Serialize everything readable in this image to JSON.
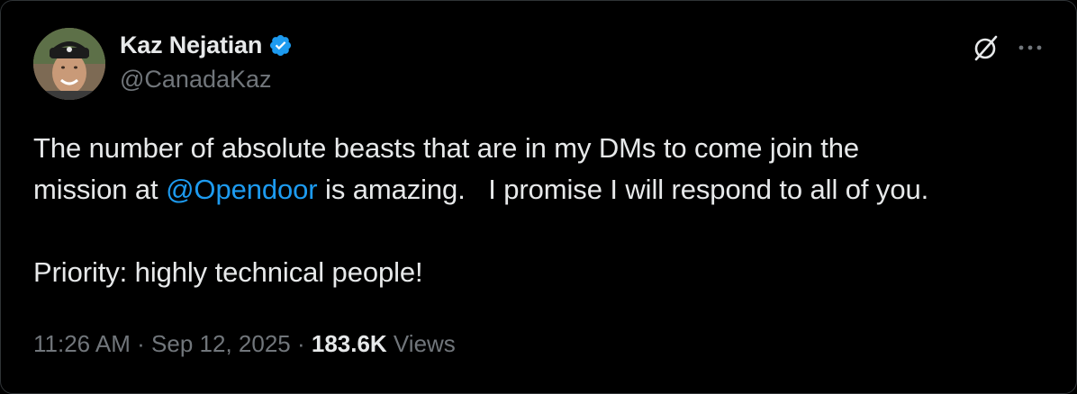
{
  "tweet": {
    "author": {
      "display_name": "Kaz Nejatian",
      "handle": "@CanadaKaz",
      "verified": true,
      "verified_badge_icon": "verified-badge-icon",
      "avatar_icon": "avatar"
    },
    "text": {
      "line1": "The number of absolute beasts that are in my DMs to come join the",
      "line2_prefix": "mission at ",
      "mention": "@Opendoor",
      "line2_suffix": " is amazing.   I promise I will respond to all of you.",
      "line3": "",
      "line4": "Priority: highly technical people!"
    },
    "meta": {
      "time": "11:26 AM",
      "separator": " · ",
      "date": "Sep 12, 2025",
      "views_count": "183.6K",
      "views_label": " Views"
    },
    "actions": {
      "grok_icon": "grok-icon",
      "more_icon": "more-options-icon"
    }
  },
  "colors": {
    "background": "#000000",
    "text_primary": "#e7e9ea",
    "text_secondary": "#71767b",
    "accent_blue": "#1d9bf0",
    "border": "#2f3336"
  }
}
